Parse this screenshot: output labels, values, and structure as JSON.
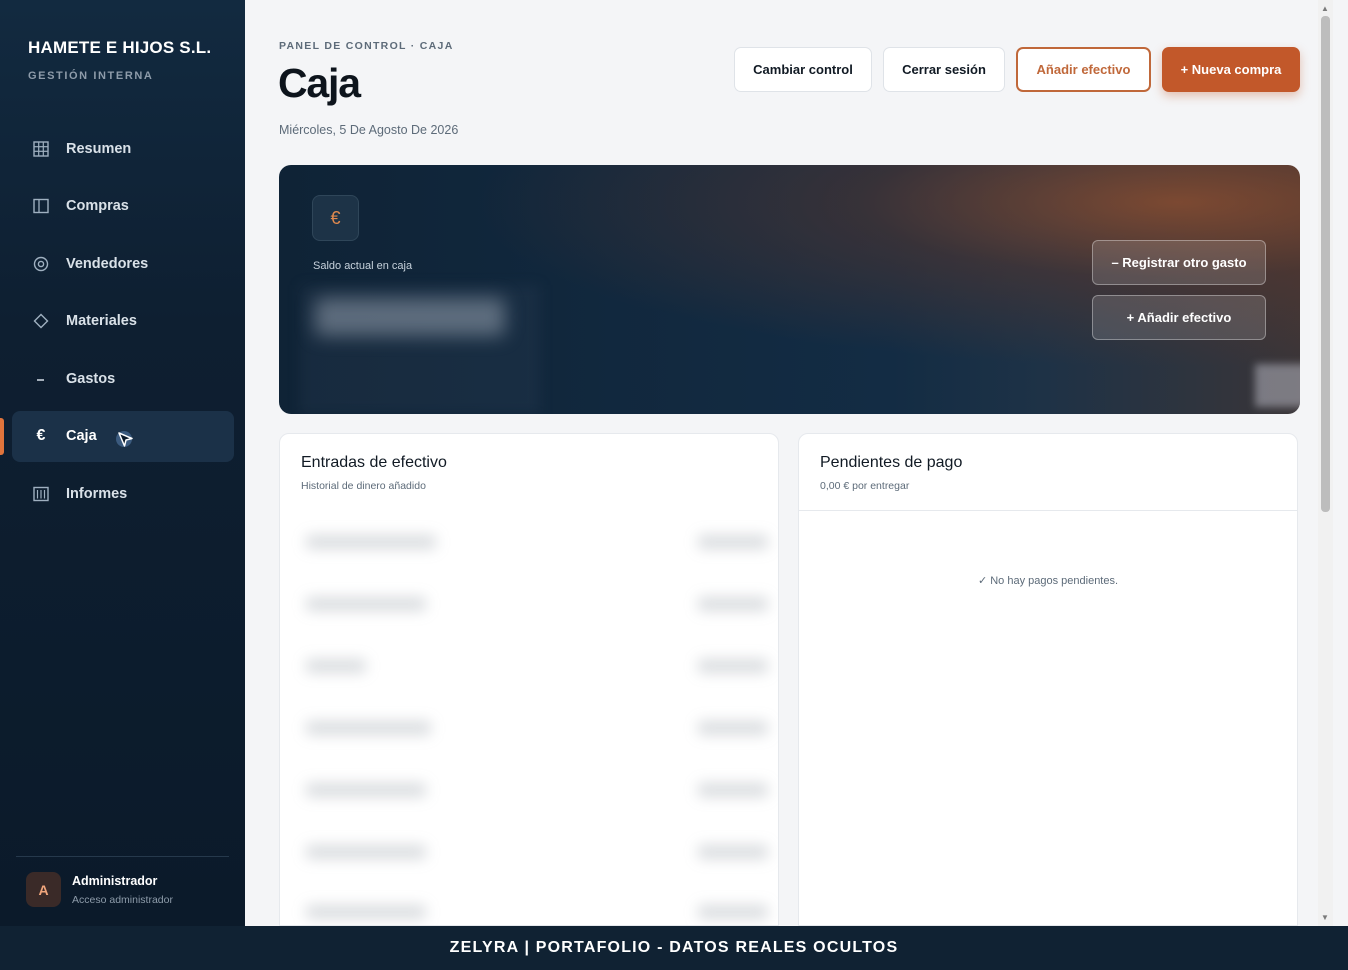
{
  "sidebar": {
    "brand": "HAMETE E HIJOS S.L.",
    "subtitle": "GESTIÓN INTERNA",
    "items": [
      {
        "label": "Resumen",
        "icon": "grid-icon"
      },
      {
        "label": "Compras",
        "icon": "book-icon"
      },
      {
        "label": "Vendedores",
        "icon": "target-icon"
      },
      {
        "label": "Materiales",
        "icon": "diamond-icon"
      },
      {
        "label": "Gastos",
        "icon": "minus-icon"
      },
      {
        "label": "Caja",
        "icon": "euro-icon",
        "active": true
      },
      {
        "label": "Informes",
        "icon": "report-icon"
      }
    ],
    "user": {
      "initial": "A",
      "name": "Administrador",
      "role": "Acceso administrador"
    }
  },
  "header": {
    "breadcrumb": "PANEL DE CONTROL · CAJA",
    "title": "Caja",
    "date": "Miércoles, 5 De Agosto De 2026",
    "actions": {
      "switch": "Cambiar control",
      "logout": "Cerrar sesión",
      "add_cash": "Añadir efectivo",
      "new_purchase": "+ Nueva compra"
    }
  },
  "balance": {
    "label": "Saldo actual en caja",
    "register_expense": "– Registrar otro gasto",
    "add_cash": "+ Añadir efectivo"
  },
  "entries": {
    "title": "Entradas de efectivo",
    "subtitle": "Historial de dinero añadido"
  },
  "pending": {
    "title": "Pendientes de pago",
    "amount": "0,00 €",
    "amount_suffix": "por entregar",
    "empty": "✓ No hay pagos pendientes."
  },
  "banner": "ZELYRA | PORTAFOLIO - DATOS REALES OCULTOS",
  "colors": {
    "accent": "#c2582a",
    "sidebar": "#0e1f31",
    "active_bar": "#e0743c"
  }
}
